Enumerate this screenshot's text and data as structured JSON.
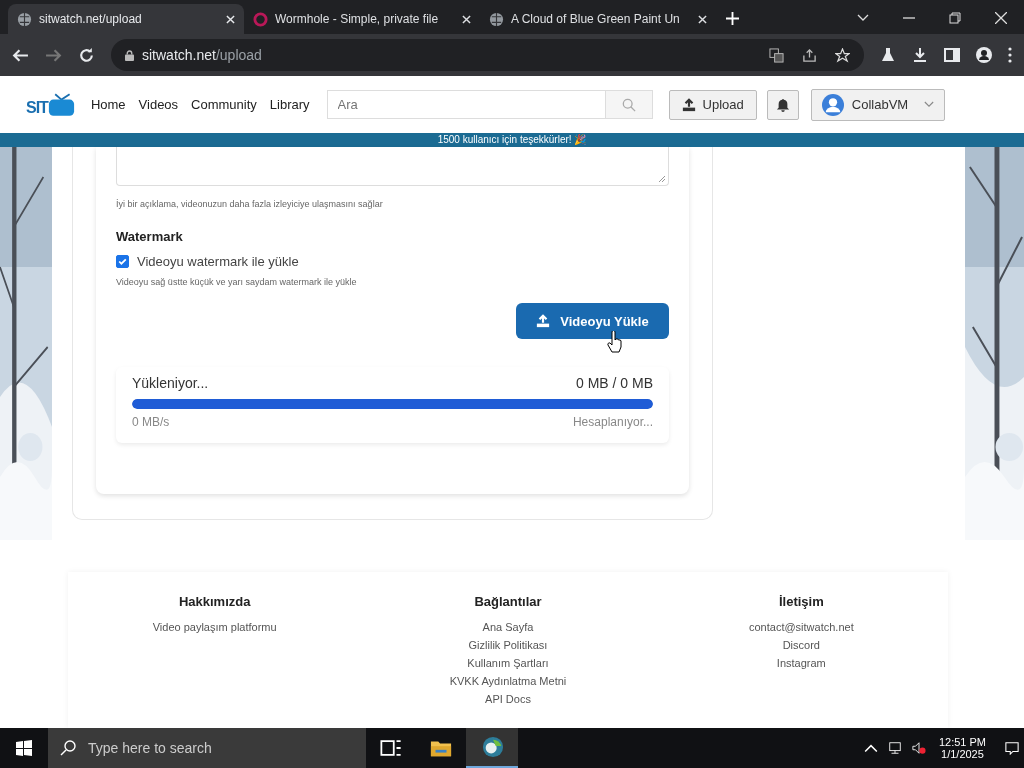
{
  "browser": {
    "tabs": [
      {
        "title": "sitwatch.net/upload",
        "selected": true
      },
      {
        "title": "Wormhole - Simple, private file",
        "selected": false
      },
      {
        "title": "A Cloud of Blue Green Paint Un",
        "selected": false
      }
    ],
    "url_host": "sitwatch.net",
    "url_path": "/upload"
  },
  "site": {
    "logo": "SIT",
    "nav": [
      "Home",
      "Videos",
      "Community",
      "Library"
    ],
    "search": {
      "placeholder": "Ara"
    },
    "upload_button": "Upload",
    "account": "CollabVM"
  },
  "banner": "1500 kullanıcı için teşekkürler! 🎉",
  "form": {
    "description_hint": "İyi bir açıklama, videonuzun daha fazla izleyiciye ulaşmasını sağlar",
    "watermark_title": "Watermark",
    "watermark_label": "Videoyu watermark ile yükle",
    "watermark_checked": true,
    "watermark_hint": "Videoyu sağ üstte küçük ve yarı saydam watermark ile yükle",
    "submit": "Videoyu Yükle",
    "progress": {
      "status": "Yükleniyor...",
      "size": "0 MB / 0 MB",
      "level": 1,
      "speed": "0 MB/s",
      "eta": "Hesaplanıyor..."
    }
  },
  "footer": [
    {
      "title": "Hakkımızda",
      "links": [
        "Video paylaşım platformu"
      ]
    },
    {
      "title": "Bağlantılar",
      "links": [
        "Ana Sayfa",
        "Gizlilik Politikası",
        "Kullanım Şartları",
        "KVKK Aydınlatma Metni",
        "API Docs"
      ]
    },
    {
      "title": "İletişim",
      "links": [
        "contact@sitwatch.net",
        "Discord",
        "Instagram"
      ]
    }
  ],
  "taskbar": {
    "search_placeholder": "Type here to search",
    "time": "12:51 PM",
    "date": "1/1/2025"
  }
}
